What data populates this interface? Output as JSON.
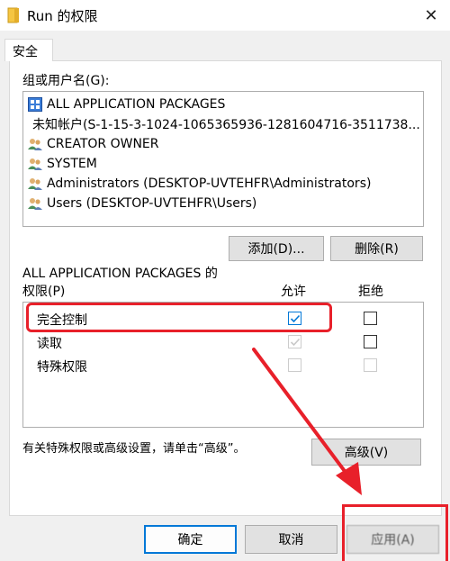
{
  "window": {
    "title": "Run 的权限",
    "close_glyph": "✕"
  },
  "tabs": [
    {
      "label": "安全"
    }
  ],
  "users_section": {
    "label": "组或用户名(G):",
    "items": [
      {
        "name": "ALL APPLICATION PACKAGES",
        "icon": "app-packages-icon"
      },
      {
        "name": "未知帐户(S-1-15-3-1024-1065365936-1281604716-3511738...",
        "icon": "unknown-account-icon"
      },
      {
        "name": "CREATOR OWNER",
        "icon": "users-group-icon"
      },
      {
        "name": "SYSTEM",
        "icon": "users-group-icon"
      },
      {
        "name": "Administrators (DESKTOP-UVTEHFR\\Administrators)",
        "icon": "users-group-icon"
      },
      {
        "name": "Users (DESKTOP-UVTEHFR\\Users)",
        "icon": "users-group-icon"
      }
    ],
    "add_button": "添加(D)...",
    "remove_button": "删除(R)"
  },
  "permissions_section": {
    "for_label": "ALL APPLICATION PACKAGES 的",
    "label": "权限(P)",
    "allow_header": "允许",
    "deny_header": "拒绝",
    "rows": [
      {
        "name": "完全控制",
        "allow": true,
        "deny": false
      },
      {
        "name": "读取",
        "allow": true,
        "deny": false
      },
      {
        "name": "特殊权限",
        "allow": false,
        "deny": false
      }
    ]
  },
  "advanced_note": "有关特殊权限或高级设置，请单击“高级”。",
  "advanced_button": "高级(V)",
  "footer": {
    "ok_button": "确定",
    "cancel_button": "取消",
    "apply_button": "应用(A)"
  },
  "colors": {
    "annotation_red": "#e8202a",
    "check_blue": "#0078d7",
    "focus_blue": "#0078d7"
  }
}
